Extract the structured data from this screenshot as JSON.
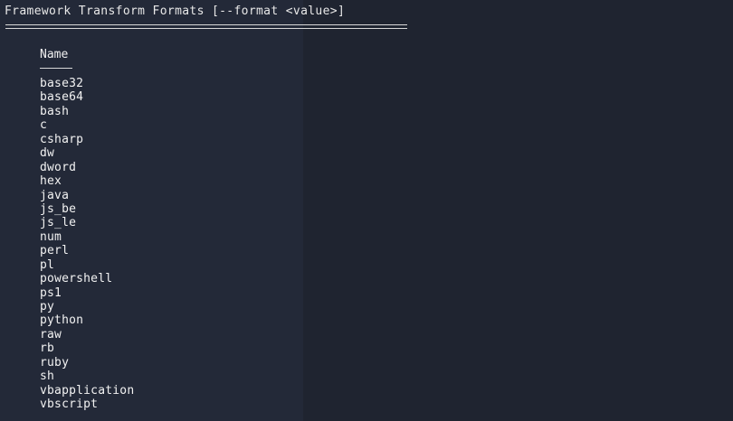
{
  "terminal": {
    "title": "Framework Transform Formats [--format <value>]",
    "column_header": "Name",
    "formats": [
      "base32",
      "base64",
      "bash",
      "c",
      "csharp",
      "dw",
      "dword",
      "hex",
      "java",
      "js_be",
      "js_le",
      "num",
      "perl",
      "pl",
      "powershell",
      "ps1",
      "py",
      "python",
      "raw",
      "rb",
      "ruby",
      "sh",
      "vbapplication",
      "vbscript"
    ]
  },
  "colors": {
    "background": "#1f2430",
    "left_panel": "#232938",
    "text": "#e6e6e6"
  }
}
